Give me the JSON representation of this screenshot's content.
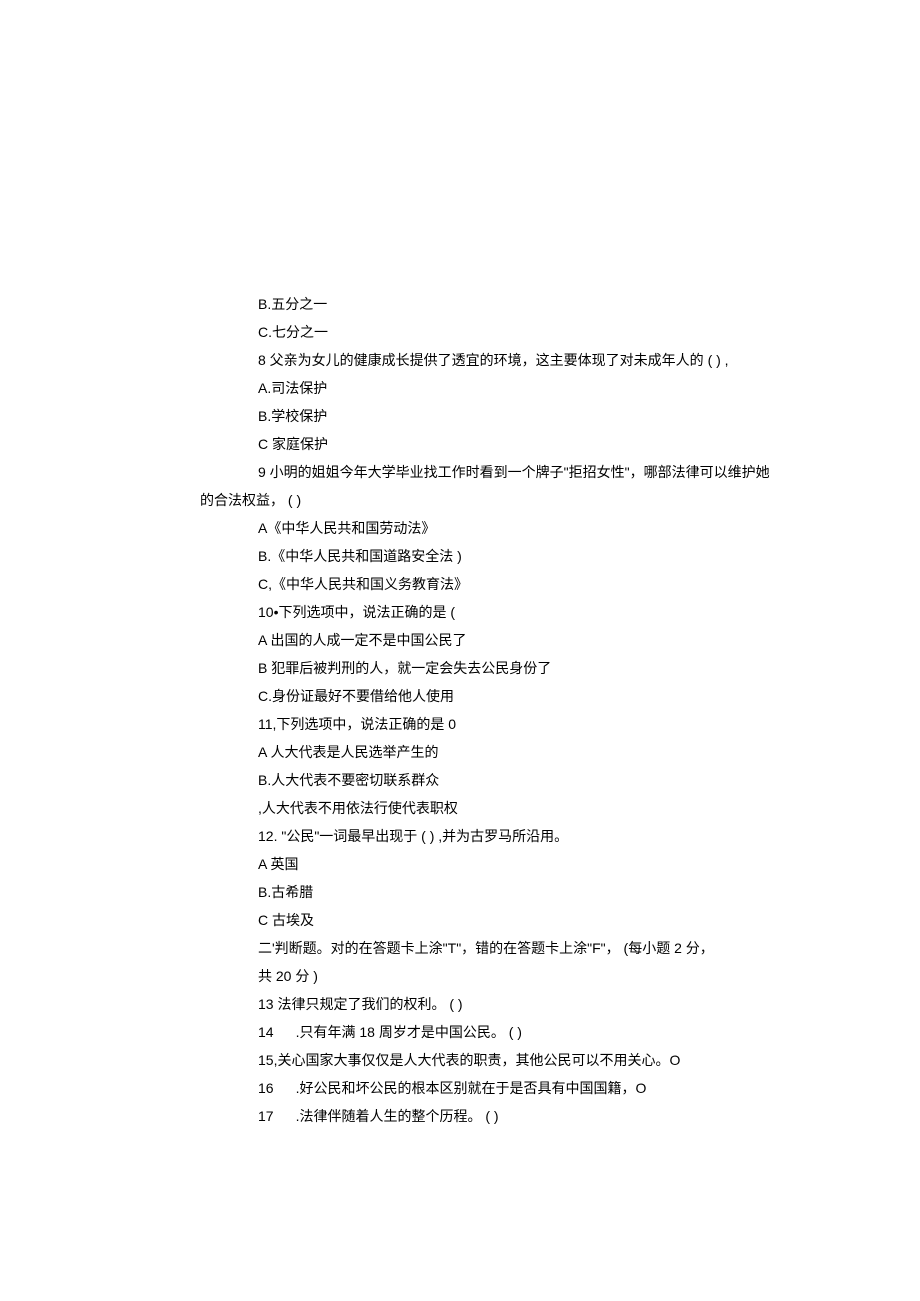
{
  "lines": {
    "l1": "B.五分之一",
    "l2": "C.七分之一",
    "l3": "8 父亲为女儿的健康成长提供了透宜的环境，这主要体现了对未成年人的 ( ) ,",
    "l4": "A.司法保护",
    "l5": "B.学校保护",
    "l6": "C 家庭保护",
    "l7": "9 小明的姐姐今年大学毕业找工作时看到一个牌子\"拒招女性\"，哪部法律可以维护她",
    "l8": "的合法权益， ( )",
    "l9": "A《中华人民共和国劳动法》",
    "l10": "B.《中华人民共和国道路安全法 )",
    "l11": "C,《中华人民共和国义务教育法》",
    "l12": "10•下列选项中，说法正确的是 (",
    "l13": "A 出国的人成一定不是中国公民了",
    "l14": "B 犯罪后被判刑的人，就一定会失去公民身份了",
    "l15": "C.身份证最好不要借给他人使用",
    "l16": "11,下列选项中，说法正确的是 0",
    "l17": "A 人大代表是人民选举产生的",
    "l18": "B.人大代表不要密切联系群众",
    "l19": ",人大代表不用依法行使代表职权",
    "l20": "12. \"公民\"一词最早出现于 (  ) ,并为古罗马所沿用。",
    "l21": "A 英国",
    "l22": "B.古希腊",
    "l23": "C 古埃及",
    "l24": "二'判断题。对的在答题卡上涂\"T\"，错的在答题卡上涂\"F\"， (每小题 2 分，",
    "l25": "共 20 分 )",
    "l26": "13 法律只规定了我们的权利。 ( )",
    "l27": "14",
    "l27b": ".只有年满 18 周岁才是中国公民。 ( )",
    "l28": "15,关心国家大事仅仅是人大代表的职责，其他公民可以不用关心。O",
    "l29": "16",
    "l29b": ".好公民和坏公民的根本区别就在于是否具有中国国籍，O",
    "l30": "17",
    "l30b": ".法律伴随着人生的整个历程。 ( )"
  }
}
